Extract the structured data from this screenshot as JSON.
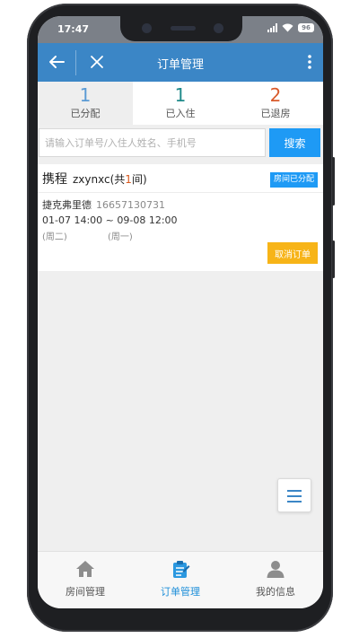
{
  "statusbar": {
    "time": "17:47",
    "battery": "96"
  },
  "header": {
    "title": "订单管理",
    "back_icon": "back-arrow-icon",
    "close_icon": "close-icon",
    "more_icon": "more-vertical-icon"
  },
  "tabs": [
    {
      "count": "1",
      "label": "已分配",
      "color": "#5b9bd5",
      "active": true
    },
    {
      "count": "1",
      "label": "已入住",
      "color": "#1f8a8a",
      "active": false
    },
    {
      "count": "2",
      "label": "已退房",
      "color": "#d95a2b",
      "active": false
    }
  ],
  "search": {
    "placeholder": "请输入订单号/入住人姓名、手机号",
    "value": "",
    "button_label": "搜索"
  },
  "order": {
    "source": "携程",
    "room_name": "zxynxc",
    "room_count_prefix": "(共",
    "room_count": "1",
    "room_count_suffix": "间)",
    "status_badge": "房间已分配",
    "guest_name": "捷克弗里德",
    "guest_phone": "16657130731",
    "dates": "01-07 14:00 ~ 09-08 12:00",
    "checkin_weekday": "(周二)",
    "checkout_weekday": "(周一)",
    "cancel_label": "取消订单"
  },
  "fab": {
    "icon": "menu-icon"
  },
  "bottom_nav": [
    {
      "label": "房间管理",
      "icon": "house-icon",
      "active": false
    },
    {
      "label": "订单管理",
      "icon": "clipboard-icon",
      "active": true
    },
    {
      "label": "我的信息",
      "icon": "user-icon",
      "active": false
    }
  ],
  "colors": {
    "accent": "#3b86c6",
    "search_button": "#1e9af5",
    "cancel_button": "#f7b418",
    "nav_inactive": "#555555",
    "nav_active": "#1e8fd9"
  }
}
